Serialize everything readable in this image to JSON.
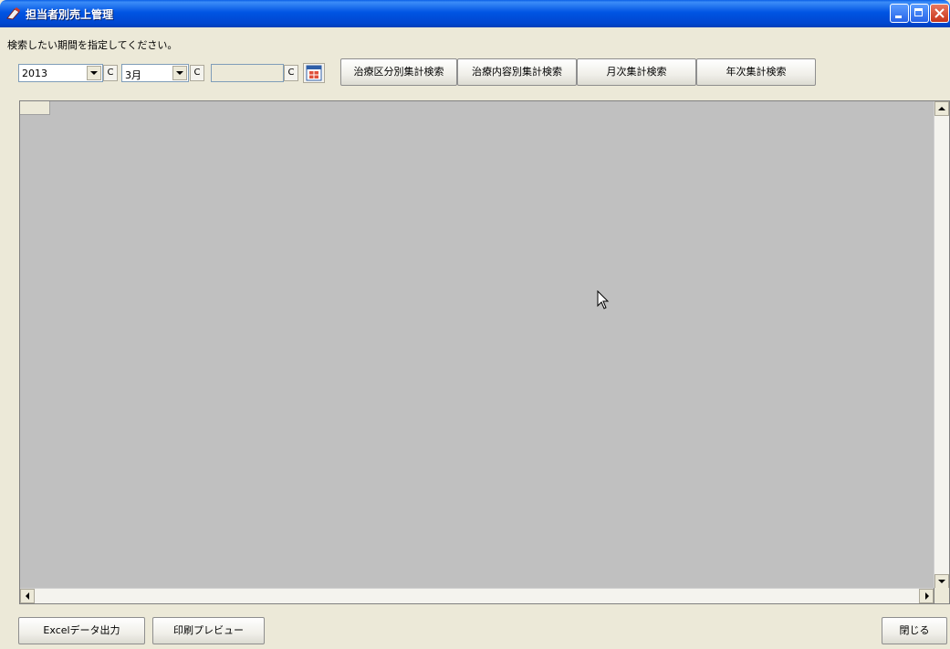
{
  "window": {
    "title": "担当者別売上管理"
  },
  "instruction": "検索したい期間を指定してください。",
  "filters": {
    "year": {
      "value": "2013",
      "clear_label": "C"
    },
    "month": {
      "value": "3月",
      "clear_label": "C"
    },
    "date": {
      "value": "",
      "clear_label": "C"
    }
  },
  "search_buttons": [
    "治療区分別集計検索",
    "治療内容別集計検索",
    "月次集計検索",
    "年次集計検索"
  ],
  "footer": {
    "excel_label": "Excelデータ出力",
    "print_label": "印刷プレビュー",
    "close_label": "閉じる"
  },
  "colors": {
    "titlebar": "#0054e3",
    "face": "#ece9d8",
    "grid_bg": "#c0c0c0"
  }
}
